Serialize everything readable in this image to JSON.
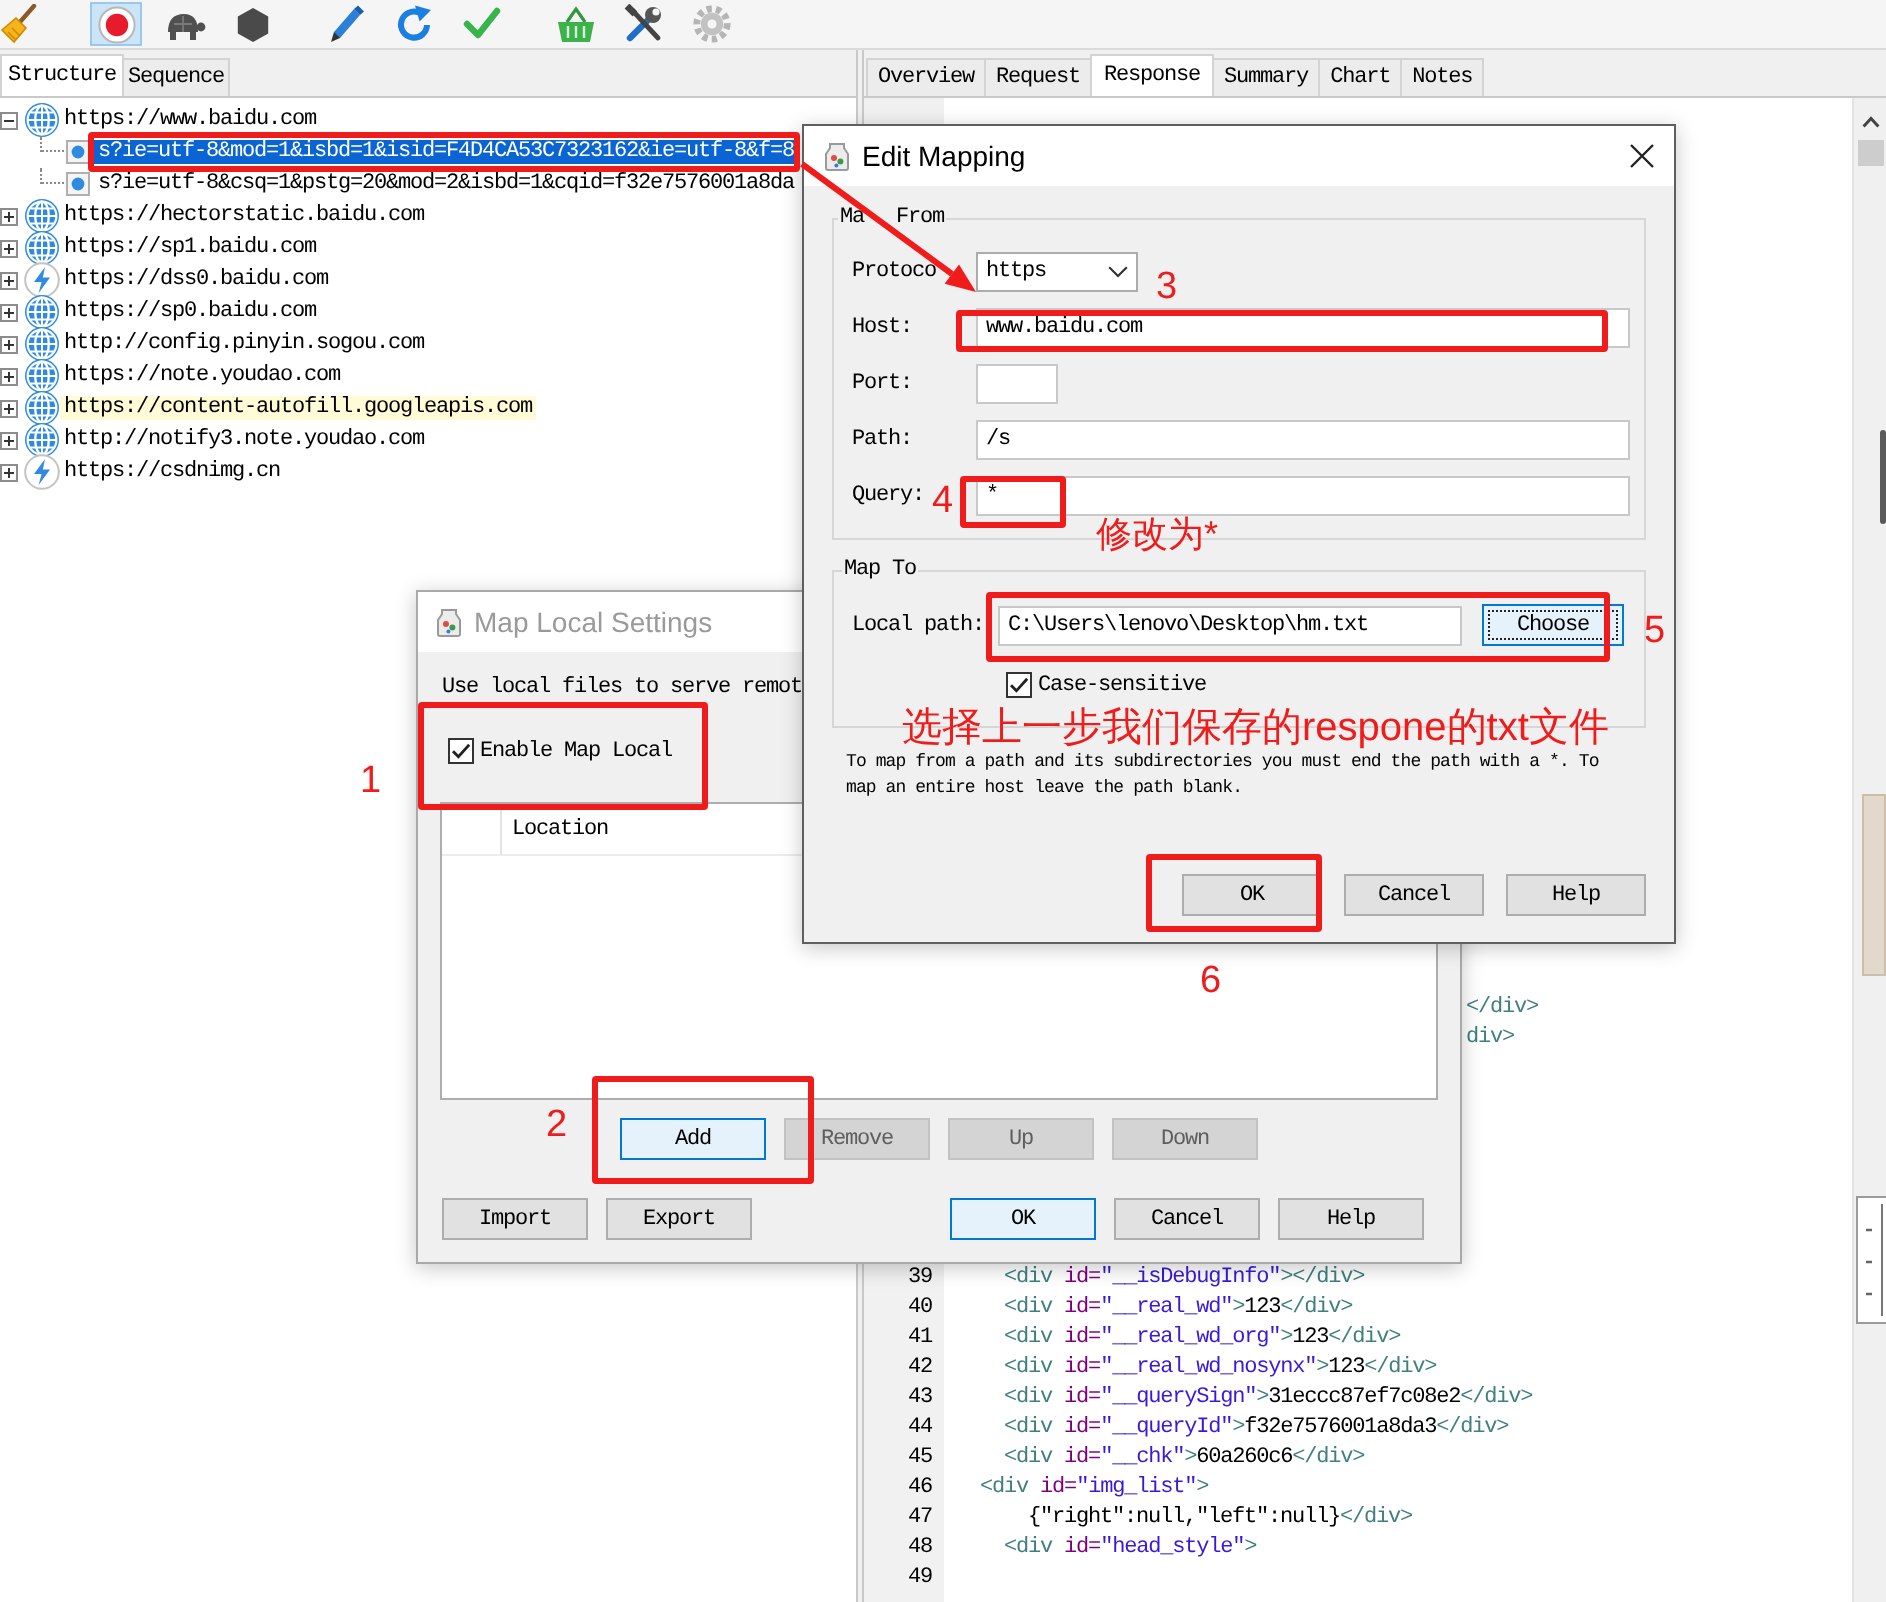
{
  "toolbar": {
    "recording": true
  },
  "structure_panel": {
    "tabs": [
      {
        "label": "Structure",
        "selected": true
      },
      {
        "label": "Sequence",
        "selected": false
      }
    ],
    "tree": [
      {
        "label": "https://www.baidu.com",
        "kind": "globe",
        "expanded": true,
        "selected": false,
        "highlighted": false,
        "children": [
          {
            "label": "s?ie=utf-8&mod=1&isbd=1&isid=F4D4CA53C7323162&ie=utf-8&f=8",
            "kind": "request",
            "selected": true,
            "highlighted": false
          },
          {
            "label": "s?ie=utf-8&csq=1&pstg=20&mod=2&isbd=1&cqid=f32e7576001a8da",
            "kind": "request",
            "selected": false,
            "highlighted": false
          }
        ]
      },
      {
        "label": "https://hectorstatic.baidu.com",
        "kind": "globe",
        "expanded": false,
        "selected": false,
        "highlighted": false
      },
      {
        "label": "https://sp1.baidu.com",
        "kind": "globe",
        "expanded": false,
        "selected": false,
        "highlighted": false
      },
      {
        "label": "https://dss0.baidu.com",
        "kind": "bolt",
        "expanded": false,
        "selected": false,
        "highlighted": false
      },
      {
        "label": "https://sp0.baidu.com",
        "kind": "globe",
        "expanded": false,
        "selected": false,
        "highlighted": false
      },
      {
        "label": "http://config.pinyin.sogou.com",
        "kind": "globe",
        "expanded": false,
        "selected": false,
        "highlighted": false
      },
      {
        "label": "https://note.youdao.com",
        "kind": "globe",
        "expanded": false,
        "selected": false,
        "highlighted": false
      },
      {
        "label": "https://content-autofill.googleapis.com",
        "kind": "globe",
        "expanded": false,
        "selected": false,
        "highlighted": true
      },
      {
        "label": "http://notify3.note.youdao.com",
        "kind": "globe",
        "expanded": false,
        "selected": false,
        "highlighted": false
      },
      {
        "label": "https://csdnimg.cn",
        "kind": "bolt",
        "expanded": false,
        "selected": false,
        "highlighted": false
      }
    ]
  },
  "response_panel": {
    "tabs": [
      {
        "label": "Overview",
        "selected": false
      },
      {
        "label": "Request",
        "selected": false
      },
      {
        "label": "Response",
        "selected": true
      },
      {
        "label": "Summary",
        "selected": false
      },
      {
        "label": "Chart",
        "selected": false
      },
      {
        "label": "Notes",
        "selected": false
      }
    ],
    "code": {
      "fragments": [
        "</div>",
        "div>"
      ],
      "lines": [
        {
          "number": "39",
          "text": "    <div id=\"__isDebugInfo\"></div>"
        },
        {
          "number": "40",
          "text": "    <div id=\"__real_wd\">123</div>"
        },
        {
          "number": "41",
          "text": "    <div id=\"__real_wd_org\">123</div>"
        },
        {
          "number": "42",
          "text": "    <div id=\"__real_wd_nosynx\">123</div>"
        },
        {
          "number": "43",
          "text": "    <div id=\"__querySign\">31eccc87ef7c08e2</div>"
        },
        {
          "number": "44",
          "text": "    <div id=\"__queryId\">f32e7576001a8da3</div>"
        },
        {
          "number": "45",
          "text": "    <div id=\"__chk\">60a260c6</div>"
        },
        {
          "number": "46",
          "text": "  <div id=\"img_list\">"
        },
        {
          "number": "47",
          "text": "      {\"right\":null,\"left\":null}</div>"
        },
        {
          "number": "48",
          "text": "    <div id=\"head_style\">"
        },
        {
          "number": "49"
        }
      ]
    }
  },
  "edit_mapping": {
    "title": "Edit Mapping",
    "active": true,
    "map_from": {
      "legend": [
        "Ma",
        "From"
      ],
      "fields": [
        {
          "label": "Protoco",
          "kind": "select",
          "value": "https"
        },
        {
          "label": "Host:",
          "kind": "text",
          "value": "www.baidu.com"
        },
        {
          "label": "Port:",
          "kind": "short"
        },
        {
          "label": "Path:",
          "kind": "text",
          "value": "/s"
        },
        {
          "label": "Query:",
          "kind": "text",
          "value": "*"
        }
      ]
    },
    "map_to": {
      "legend": "Map To",
      "local_path": {
        "label": "Local path:",
        "value": "C:\\Users\\lenovo\\Desktop\\hm.txt"
      },
      "choose_button": {
        "label": "Choose",
        "focused": true
      },
      "case_sensitive": {
        "label": "Case-sensitive",
        "checked": true
      }
    },
    "note": "To map from a path and its subdirectories you must end the path with a *. To map an entire host leave the path blank.",
    "buttons": [
      {
        "label": "OK",
        "focused": false
      },
      {
        "label": "Cancel",
        "focused": false
      },
      {
        "label": "Help",
        "focused": false
      }
    ]
  },
  "map_local_settings": {
    "title": "Map Local Settings",
    "active": false,
    "intro": "Use local files to serve remot",
    "enable": {
      "label": "Enable Map Local",
      "checked": true
    },
    "table": {
      "columns": [
        "Location"
      ]
    },
    "row_buttons": [
      {
        "label": "Add",
        "disabled": false,
        "focused": true
      },
      {
        "label": "Remove",
        "disabled": true,
        "focused": false
      },
      {
        "label": "Up",
        "disabled": true,
        "focused": false
      },
      {
        "label": "Down",
        "disabled": true,
        "focused": false
      }
    ],
    "bottom_left_buttons": [
      {
        "label": "Import",
        "focused": false
      },
      {
        "label": "Export",
        "focused": false
      }
    ],
    "bottom_right_buttons": [
      {
        "label": "OK",
        "focused": true
      },
      {
        "label": "Cancel",
        "focused": false
      },
      {
        "label": "Help",
        "focused": false
      }
    ]
  },
  "annotations": [
    {
      "kind": "frame"
    },
    {
      "kind": "arrow"
    },
    {
      "kind": "number",
      "text": "3"
    },
    {
      "kind": "frame"
    },
    {
      "kind": "number",
      "text": "4"
    },
    {
      "kind": "frame"
    },
    {
      "kind": "note",
      "text": "修改为*"
    },
    {
      "kind": "frame"
    },
    {
      "kind": "number",
      "text": "5"
    },
    {
      "kind": "note",
      "text": "选择上一步我们保存的respone的txt文件"
    },
    {
      "kind": "frame"
    },
    {
      "kind": "number",
      "text": "6"
    },
    {
      "kind": "number",
      "text": "1"
    },
    {
      "kind": "frame"
    },
    {
      "kind": "number",
      "text": "2"
    },
    {
      "kind": "frame"
    }
  ]
}
